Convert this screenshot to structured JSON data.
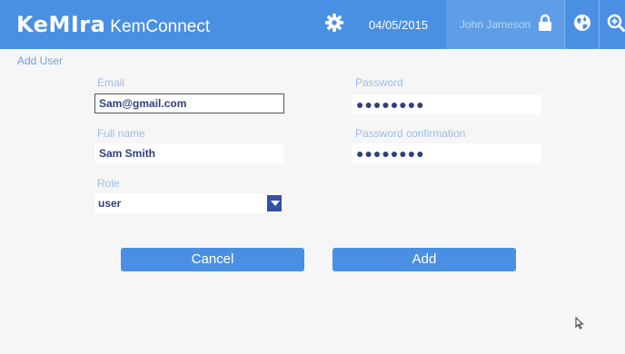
{
  "header": {
    "brand_logo": "KeMIra",
    "brand_app": "KemConnect",
    "settings_icon": "gear-icon",
    "date": "04/05/2015",
    "user_name": "John Jameson",
    "lock_icon": "lock-icon",
    "globe_icon": "globe-icon",
    "zoom_icon": "zoom-in-icon"
  },
  "page": {
    "title": "Add User"
  },
  "form": {
    "email": {
      "label": "Email",
      "value": "Sam@gmail.com"
    },
    "password": {
      "label": "Password",
      "value": "●●●●●●●●"
    },
    "full_name": {
      "label": "Full name",
      "value": "Sam Smith"
    },
    "password_confirmation": {
      "label": "Password confirmation",
      "value": "●●●●●●●●"
    },
    "role": {
      "label": "Role",
      "value": "user"
    }
  },
  "actions": {
    "cancel_label": "Cancel",
    "add_label": "Add"
  },
  "colors": {
    "header_bg": "#4a90e2",
    "accent_dark": "#3550a3",
    "label_blue": "#9cbde5",
    "value_text": "#2f3f7a"
  }
}
